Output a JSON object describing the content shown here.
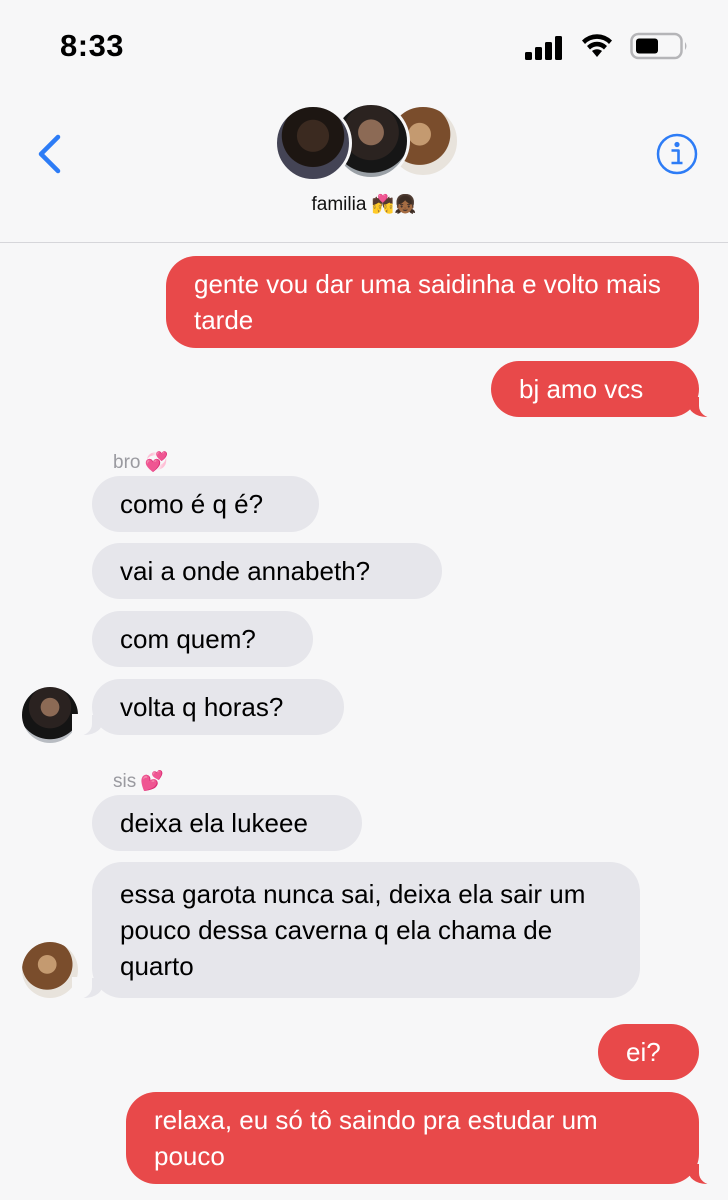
{
  "status_bar": {
    "time": "8:33"
  },
  "header": {
    "group_name": "familia",
    "group_emoji": "💏👧🏾"
  },
  "messages": [
    {
      "sender": "me",
      "text": "gente vou dar uma saidinha e volto mais tarde"
    },
    {
      "sender": "me",
      "text": "bj amo vcs"
    },
    {
      "sender": "bro",
      "sender_label": "bro",
      "sender_emoji": "💞",
      "text": "como é q é?"
    },
    {
      "sender": "bro",
      "text": "vai a onde annabeth?"
    },
    {
      "sender": "bro",
      "text": "com quem?"
    },
    {
      "sender": "bro",
      "text": "volta q horas?"
    },
    {
      "sender": "sis",
      "sender_label": "sis",
      "sender_emoji": "💕",
      "text": "deixa ela lukeee"
    },
    {
      "sender": "sis",
      "text": "essa garota nunca sai, deixa ela sair um pouco dessa caverna q ela chama de quarto"
    },
    {
      "sender": "me",
      "text": "ei?"
    },
    {
      "sender": "me",
      "text": "relaxa, eu só tô saindo pra estudar um pouco"
    }
  ],
  "colors": {
    "outgoing": "#e8494a",
    "incoming": "#e6e6eb",
    "accent": "#2d7cf6"
  },
  "icons": [
    "signal-icon",
    "wifi-icon",
    "battery-icon",
    "back-chevron-icon",
    "info-icon"
  ]
}
